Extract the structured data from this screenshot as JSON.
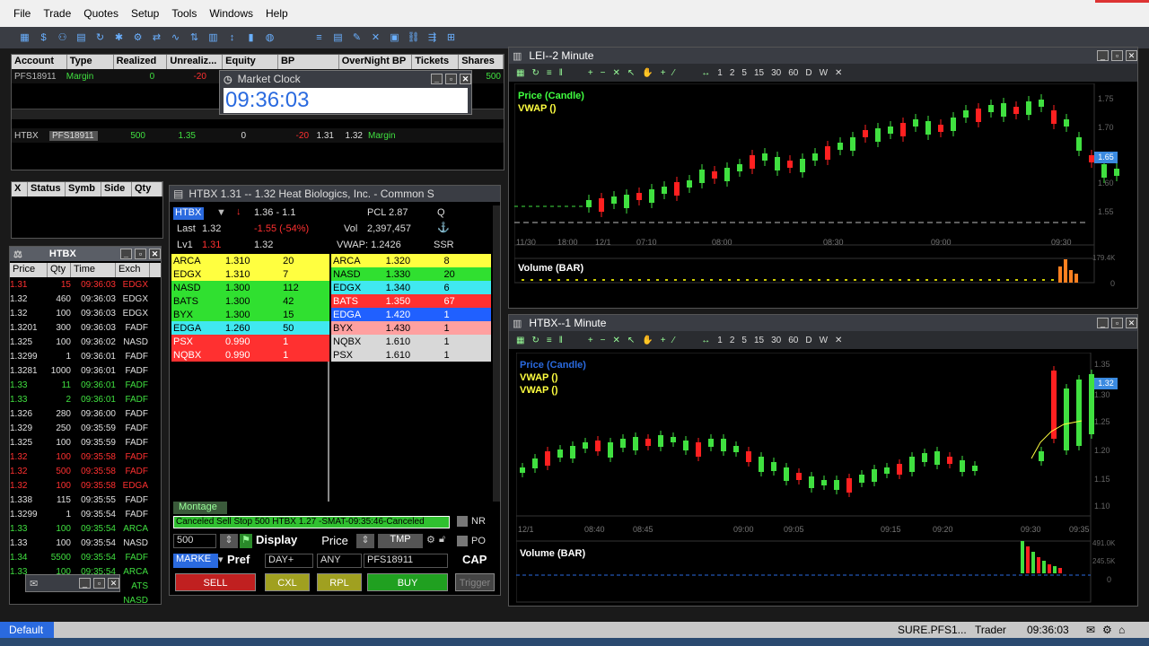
{
  "menu": [
    "File",
    "Trade",
    "Quotes",
    "Setup",
    "Tools",
    "Windows",
    "Help"
  ],
  "account": {
    "headers": [
      "Account",
      "Type",
      "Realized",
      "Unrealiz...",
      "Equity",
      "BP",
      "OverNight BP",
      "Tickets",
      "Shares"
    ],
    "row": {
      "account": "PFS18911",
      "type": "Margin",
      "realized": "0",
      "unrealized": "-20",
      "shares": "500"
    }
  },
  "position": {
    "symbol": "HTBX",
    "account": "PFS18911",
    "qty": "500",
    "price": "1.35",
    "realized": "0",
    "unrealized": "-20",
    "bid": "1.31",
    "ask": "1.32",
    "type": "Margin"
  },
  "clock": {
    "title": "Market Clock",
    "time": "09:36:03"
  },
  "orders": {
    "headers": [
      "X",
      "Status",
      "Symb",
      "Side",
      "Qty"
    ]
  },
  "ts": {
    "title": "HTBX",
    "headers": [
      "Price",
      "Qty",
      "Time",
      "Exch"
    ],
    "rows": [
      {
        "p": "1.31",
        "q": "15",
        "t": "09:36:03",
        "e": "EDGX",
        "c": "#ff3030"
      },
      {
        "p": "1.32",
        "q": "460",
        "t": "09:36:03",
        "e": "EDGX",
        "c": "#e0e0e0"
      },
      {
        "p": "1.32",
        "q": "100",
        "t": "09:36:03",
        "e": "EDGX",
        "c": "#e0e0e0"
      },
      {
        "p": "1.3201",
        "q": "300",
        "t": "09:36:03",
        "e": "FADF",
        "c": "#e0e0e0"
      },
      {
        "p": "1.325",
        "q": "100",
        "t": "09:36:02",
        "e": "NASD",
        "c": "#e0e0e0"
      },
      {
        "p": "1.3299",
        "q": "1",
        "t": "09:36:01",
        "e": "FADF",
        "c": "#e0e0e0"
      },
      {
        "p": "1.3281",
        "q": "1000",
        "t": "09:36:01",
        "e": "FADF",
        "c": "#e0e0e0"
      },
      {
        "p": "1.33",
        "q": "11",
        "t": "09:36:01",
        "e": "FADF",
        "c": "#40e040"
      },
      {
        "p": "1.33",
        "q": "2",
        "t": "09:36:01",
        "e": "FADF",
        "c": "#40e040"
      },
      {
        "p": "1.326",
        "q": "280",
        "t": "09:36:00",
        "e": "FADF",
        "c": "#e0e0e0"
      },
      {
        "p": "1.329",
        "q": "250",
        "t": "09:35:59",
        "e": "FADF",
        "c": "#e0e0e0"
      },
      {
        "p": "1.325",
        "q": "100",
        "t": "09:35:59",
        "e": "FADF",
        "c": "#e0e0e0"
      },
      {
        "p": "1.32",
        "q": "100",
        "t": "09:35:58",
        "e": "FADF",
        "c": "#ff3030"
      },
      {
        "p": "1.32",
        "q": "500",
        "t": "09:35:58",
        "e": "FADF",
        "c": "#ff3030"
      },
      {
        "p": "1.32",
        "q": "100",
        "t": "09:35:58",
        "e": "EDGA",
        "c": "#ff3030"
      },
      {
        "p": "1.338",
        "q": "115",
        "t": "09:35:55",
        "e": "FADF",
        "c": "#e0e0e0"
      },
      {
        "p": "1.3299",
        "q": "1",
        "t": "09:35:54",
        "e": "FADF",
        "c": "#e0e0e0"
      },
      {
        "p": "1.33",
        "q": "100",
        "t": "09:35:54",
        "e": "ARCA",
        "c": "#40e040"
      },
      {
        "p": "1.33",
        "q": "100",
        "t": "09:35:54",
        "e": "NASD",
        "c": "#e0e0e0"
      },
      {
        "p": "1.34",
        "q": "5500",
        "t": "09:35:54",
        "e": "FADF",
        "c": "#40e040"
      },
      {
        "p": "1.33",
        "q": "100",
        "t": "09:35:54",
        "e": "ARCA",
        "c": "#40e040"
      },
      {
        "p": "",
        "q": "",
        "t": "",
        "e": "ATS",
        "c": "#40e040"
      },
      {
        "p": "",
        "q": "",
        "t": "",
        "e": "NASD",
        "c": "#40e040"
      }
    ]
  },
  "montage": {
    "title": "HTBX   1.31 -- 1.32   Heat Biologics, Inc. - Common S",
    "symbol": "HTBX",
    "range": "1.36 - 1.1",
    "pcl": "PCL 2.87",
    "q": "Q",
    "last_label": "Last",
    "last": "1.32",
    "change": "-1.55  (-54%)",
    "vol_label": "Vol",
    "vol": "2,397,457",
    "lv1_label": "Lv1",
    "lv1_bid": "1.31",
    "lv1_ask": "1.32",
    "vwap": "VWAP: 1.2426",
    "ssr": "SSR",
    "bids": [
      {
        "mm": "ARCA",
        "p": "1.310",
        "s": "20",
        "bg": "#ffff40",
        "fg": "#000"
      },
      {
        "mm": "EDGX",
        "p": "1.310",
        "s": "7",
        "bg": "#ffff40",
        "fg": "#000"
      },
      {
        "mm": "NASD",
        "p": "1.300",
        "s": "112",
        "bg": "#30e030",
        "fg": "#000"
      },
      {
        "mm": "BATS",
        "p": "1.300",
        "s": "42",
        "bg": "#30e030",
        "fg": "#000"
      },
      {
        "mm": "BYX",
        "p": "1.300",
        "s": "15",
        "bg": "#30e030",
        "fg": "#000"
      },
      {
        "mm": "EDGA",
        "p": "1.260",
        "s": "50",
        "bg": "#40e8f0",
        "fg": "#000"
      },
      {
        "mm": "PSX",
        "p": "0.990",
        "s": "1",
        "bg": "#ff3030",
        "fg": "#fff"
      },
      {
        "mm": "NQBX",
        "p": "0.990",
        "s": "1",
        "bg": "#ff3030",
        "fg": "#fff"
      }
    ],
    "asks": [
      {
        "mm": "ARCA",
        "p": "1.320",
        "s": "8",
        "bg": "#ffff40",
        "fg": "#000"
      },
      {
        "mm": "NASD",
        "p": "1.330",
        "s": "20",
        "bg": "#30e030",
        "fg": "#000"
      },
      {
        "mm": "EDGX",
        "p": "1.340",
        "s": "6",
        "bg": "#40e8f0",
        "fg": "#000"
      },
      {
        "mm": "BATS",
        "p": "1.350",
        "s": "67",
        "bg": "#ff3030",
        "fg": "#fff"
      },
      {
        "mm": "EDGA",
        "p": "1.420",
        "s": "1",
        "bg": "#2060ff",
        "fg": "#fff"
      },
      {
        "mm": "BYX",
        "p": "1.430",
        "s": "1",
        "bg": "#ffa0a0",
        "fg": "#000"
      },
      {
        "mm": "NQBX",
        "p": "1.610",
        "s": "1",
        "bg": "#d8d8d8",
        "fg": "#000"
      },
      {
        "mm": "PSX",
        "p": "1.610",
        "s": "1",
        "bg": "#d8d8d8",
        "fg": "#000"
      }
    ],
    "tab": "Montage",
    "message": "Canceled Sell Stop 500 HTBX 1.27 -SMAT-09:35:46-Canceled",
    "nr": "NR",
    "po": "PO",
    "qty": "500",
    "display": "Display",
    "price": "Price",
    "tmp": "TMP",
    "order_type": "MARKE",
    "pref": "Pref",
    "tif": "DAY+",
    "route": "ANY",
    "acct": "PFS18911",
    "cap": "CAP",
    "sell": "SELL",
    "cxl": "CXL",
    "rpl": "RPL",
    "buy": "BUY",
    "trigger": "Trigger"
  },
  "chart1": {
    "title": "LEI--2 Minute",
    "tf": [
      "1",
      "2",
      "5",
      "15",
      "30",
      "60",
      "D",
      "W"
    ],
    "legend1": "Price (Candle)",
    "legend2": "VWAP ()",
    "yticks": [
      "1.75",
      "1.70",
      "1.65",
      "1.60",
      "1.55"
    ],
    "last_tag": "1.65",
    "xticks": [
      "11/30",
      "18:00",
      "12/1",
      "07:10",
      "08:00",
      "08:30",
      "09:00",
      "09:30"
    ],
    "vol_label": "Volume (BAR)",
    "vol_ticks": [
      "179.4K",
      "0"
    ]
  },
  "chart2": {
    "title": "HTBX--1 Minute",
    "tf": [
      "1",
      "2",
      "5",
      "15",
      "30",
      "60",
      "D",
      "W"
    ],
    "legend1": "Price (Candle)",
    "legend2": "VWAP ()",
    "legend3": "VWAP ()",
    "yticks": [
      "1.35",
      "1.30",
      "1.25",
      "1.20",
      "1.15",
      "1.10"
    ],
    "last_tag": "1.32",
    "xticks": [
      "12/1",
      "08:40",
      "08:45",
      "09:00",
      "09:05",
      "09:15",
      "09:20",
      "09:30",
      "09:35"
    ],
    "vol_label": "Volume (BAR)",
    "vol_ticks": [
      "491.0K",
      "245.5K",
      "0"
    ]
  },
  "statusbar": {
    "left": "Default",
    "acct": "SURE.PFS1...",
    "role": "Trader",
    "time": "09:36:03"
  }
}
